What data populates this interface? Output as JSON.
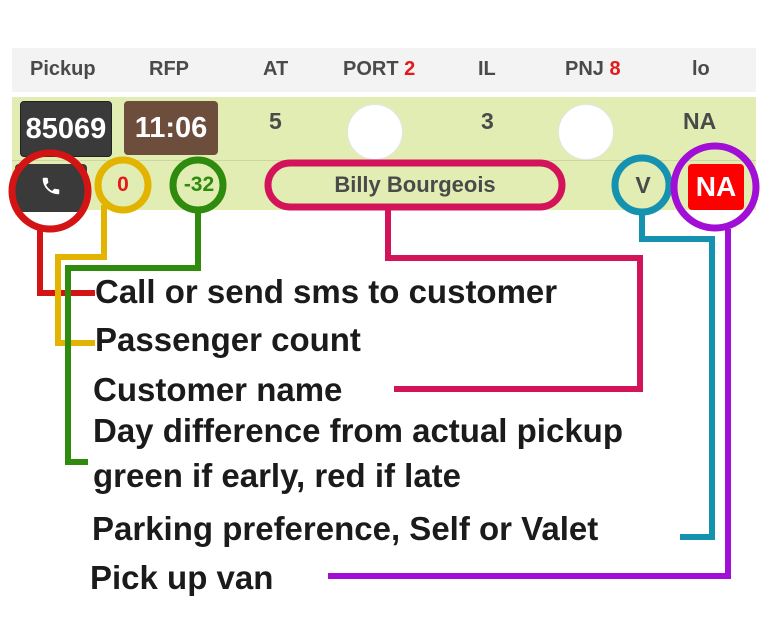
{
  "header": {
    "pickup": "Pickup",
    "rfp": "RFP",
    "at": "AT",
    "port": "PORT",
    "port_count": "2",
    "il": "IL",
    "pnj": "PNJ",
    "pnj_count": "8",
    "lo": "lo"
  },
  "row": {
    "pickup_id": "85069",
    "rfp_time": "11:06",
    "at_value": "5",
    "il_value": "3",
    "lo_value": "NA",
    "passenger_count": "0",
    "day_difference": "-32",
    "customer_name": "Billy Bourgeois",
    "parking": "V",
    "van": "NA"
  },
  "annotations": {
    "call": "Call or send sms to customer",
    "passengers": "Passenger count",
    "name": "Customer name",
    "day_diff_line1": "Day difference from actual pickup",
    "day_diff_line2": "green if early, red if late",
    "parking": "Parking preference, Self or Valet",
    "van": "Pick up van"
  },
  "colors": {
    "row_bg": "#e2edb4",
    "header_bg": "#f3f3f3",
    "red": "#e21a1a",
    "call_marker": "#d41414",
    "passenger_marker": "#e2b400",
    "daydiff_marker": "#2e8b0e",
    "name_marker": "#d4145a",
    "parking_marker": "#1592b0",
    "van_marker": "#a10fd6"
  },
  "icons": {
    "call": "phone-icon"
  }
}
